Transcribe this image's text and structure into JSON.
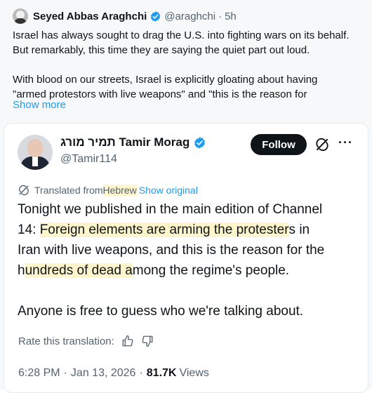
{
  "outer_tweet": {
    "author_name": "Seyed Abbas Araghchi",
    "author_handle": "@araghchi",
    "time": "5h",
    "lines_p1": [
      "Israel has always sought to drag the U.S. into fighting wars on its behalf.",
      "But remarkably, this time they are saying the quiet part out loud."
    ],
    "lines_p2": [
      "With blood on our streets, Israel is explicitly gloating about having",
      "\"armed protestors with live weapons\" and \"this is the reason for"
    ],
    "show_more": "Show more"
  },
  "quoted_tweet": {
    "author_name": "תמיר מורג Tamir Morag",
    "author_handle": "@Tamir114",
    "follow_label": "Follow",
    "translated_prefix": "Translated from ",
    "translated_language": "Hebrew",
    "show_original": "Show original",
    "line1": "Tonight we published in the main edition of Channel",
    "line2_a": "14: ",
    "line2_hl": "Foreign elements are arming the protester",
    "line2_b": "s in",
    "line3": "Iran with live weapons, and this is the reason for the",
    "line4_a": "h",
    "line4_hl": "undreds of dead a",
    "line4_b": "mong the regime's people.",
    "line5": "Anyone is free to guess who we're talking about.",
    "rate_label": "Rate this translation:",
    "time": "6:28 PM",
    "date": "Jan 13, 2026",
    "views_count": "81.7K",
    "views_label": "Views"
  },
  "colors": {
    "link": "#1d9bf0",
    "secondary_text": "#536471",
    "highlight": "#fff5cc",
    "follow_bg": "#0f1419"
  }
}
